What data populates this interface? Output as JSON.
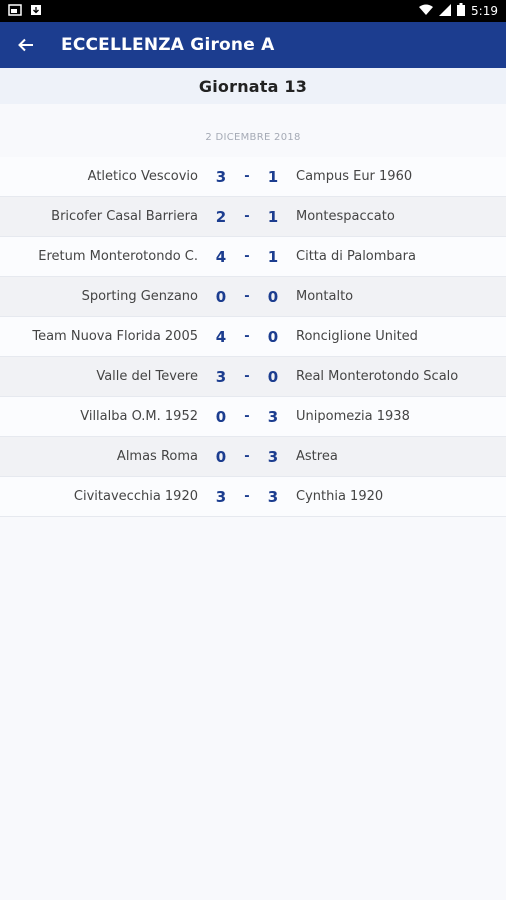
{
  "status": {
    "time": "5:19"
  },
  "appbar": {
    "title": "ECCELLENZA Girone A"
  },
  "round": {
    "title": "Giornata 13",
    "date": "2 DICEMBRE 2018"
  },
  "matches": [
    {
      "home": "Atletico Vescovio",
      "home_score": "3",
      "away_score": "1",
      "away": "Campus Eur 1960"
    },
    {
      "home": "Bricofer Casal Barriera",
      "home_score": "2",
      "away_score": "1",
      "away": "Montespaccato"
    },
    {
      "home": "Eretum Monterotondo C.",
      "home_score": "4",
      "away_score": "1",
      "away": "Citta di Palombara"
    },
    {
      "home": "Sporting Genzano",
      "home_score": "0",
      "away_score": "0",
      "away": "Montalto"
    },
    {
      "home": "Team Nuova Florida 2005",
      "home_score": "4",
      "away_score": "0",
      "away": "Ronciglione United"
    },
    {
      "home": "Valle del Tevere",
      "home_score": "3",
      "away_score": "0",
      "away": "Real Monterotondo Scalo"
    },
    {
      "home": "Villalba O.M. 1952",
      "home_score": "0",
      "away_score": "3",
      "away": "Unipomezia 1938"
    },
    {
      "home": "Almas Roma",
      "home_score": "0",
      "away_score": "3",
      "away": "Astrea"
    },
    {
      "home": "Civitavecchia 1920",
      "home_score": "3",
      "away_score": "3",
      "away": "Cynthia 1920"
    }
  ],
  "separator": "-",
  "colors": {
    "primary": "#1c3d8f",
    "statusbar": "#000000"
  }
}
